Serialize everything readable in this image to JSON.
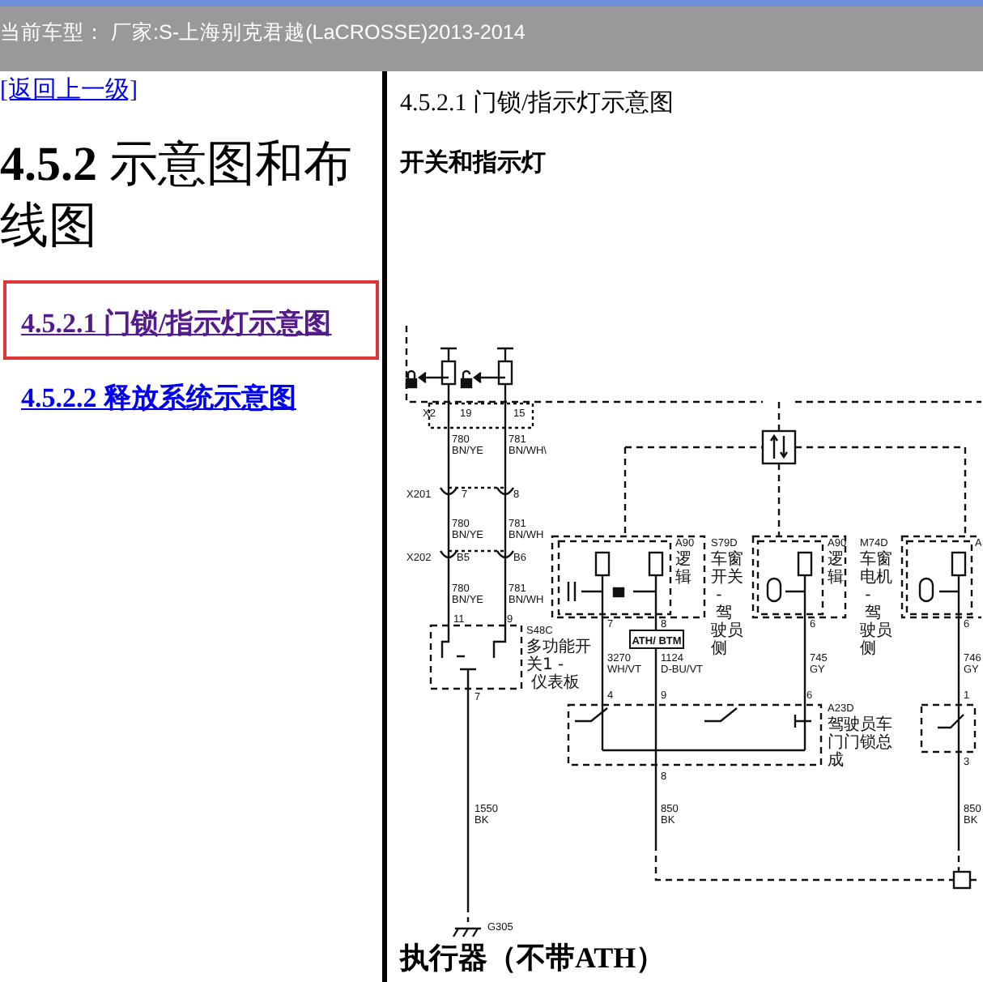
{
  "header": {
    "vehicle": "当前车型： 厂家:S-上海别克君越(LaCROSSE)2013-2014"
  },
  "sidebar": {
    "back_link": "[返回上一级]",
    "heading": "**4.5.2** 示意图和布线图",
    "links": [
      {
        "label": "4.5.2.1 门锁/指示灯示意图",
        "selected": true
      },
      {
        "label": "4.5.2.2 释放系统示意图",
        "selected": false
      }
    ]
  },
  "content": {
    "title": "4.5.2.1 门锁/指示灯示意图",
    "section": "开关和指示灯",
    "diagram": {
      "connector_tag": "ATH/ BTM",
      "labels": [
        {
          "text": "X2"
        },
        {
          "text": "19"
        },
        {
          "text": "15"
        },
        {
          "text": "780 BN/YE"
        },
        {
          "text": "781 BN/WH\\"
        },
        {
          "text": "X201"
        },
        {
          "text": "7"
        },
        {
          "text": "8"
        },
        {
          "text": "780 BN/YE"
        },
        {
          "text": "781 BN/WH"
        },
        {
          "text": "X202"
        },
        {
          "text": "B5"
        },
        {
          "text": "B6"
        },
        {
          "text": "780 BN/YE"
        },
        {
          "text": "781 BN/WH"
        },
        {
          "text": "11"
        },
        {
          "text": "9"
        },
        {
          "text": "S48C"
        },
        {
          "text": "多功能开关1 - 仪表板"
        },
        {
          "text": "7"
        },
        {
          "text": "1550 BK"
        },
        {
          "text": "G305"
        },
        {
          "text": "S79D"
        },
        {
          "text": "车窗开关 - 驾驶员侧"
        },
        {
          "text": "A90"
        },
        {
          "text": "逻辑"
        },
        {
          "text": "A90"
        },
        {
          "text": "逻辑"
        },
        {
          "text": "M74D"
        },
        {
          "text": "车窗电机 - 驾驶员侧"
        },
        {
          "text": "A"
        },
        {
          "text": "7"
        },
        {
          "text": "8"
        },
        {
          "text": "6"
        },
        {
          "text": "6"
        },
        {
          "text": "3270 WH/VT"
        },
        {
          "text": "1124 D-BU/VT"
        },
        {
          "text": "745 GY"
        },
        {
          "text": "746 GY"
        },
        {
          "text": "4"
        },
        {
          "text": "9"
        },
        {
          "text": "6"
        },
        {
          "text": "1"
        },
        {
          "text": "A23D"
        },
        {
          "text": "驾驶员车门门锁总成"
        },
        {
          "text": "8"
        },
        {
          "text": "3"
        },
        {
          "text": "850 BK"
        },
        {
          "text": "850 BK"
        }
      ]
    },
    "next_heading": "执行器（不带ATH）"
  }
}
